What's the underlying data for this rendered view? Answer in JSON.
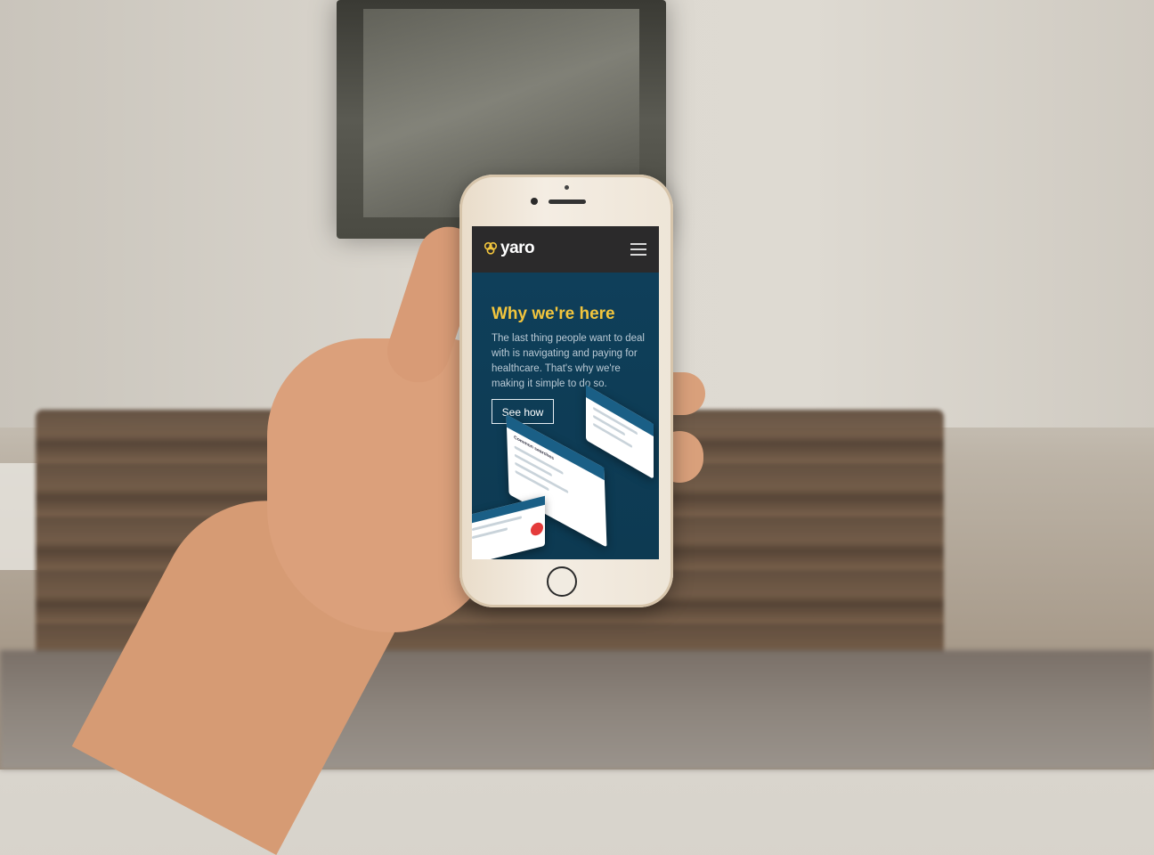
{
  "app": {
    "brand": "yaro"
  },
  "hero": {
    "title": "Why we're here",
    "body": "The last thing people want to deal with is navigating and paying for healthcare. That's why we're making it simple to do so.",
    "cta_label": "See how"
  },
  "mockups": {
    "list_title": "Common searches"
  },
  "colors": {
    "topbar": "#2b2a2b",
    "hero_bg": "#0e3b55",
    "accent": "#f2c53d"
  },
  "icons": [
    "yaro-logo-icon",
    "hamburger-menu-icon"
  ]
}
